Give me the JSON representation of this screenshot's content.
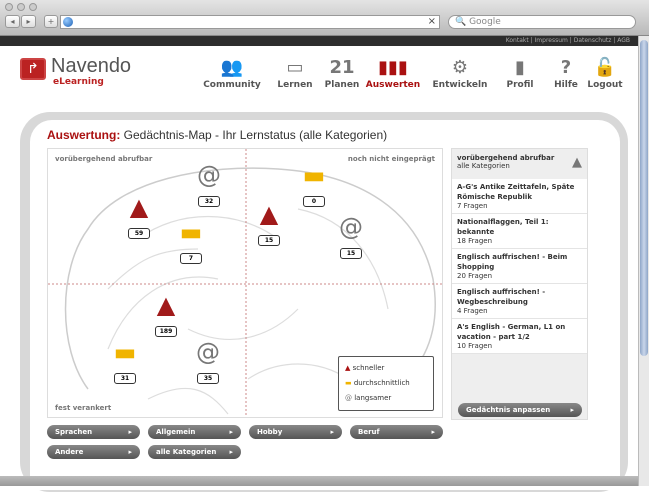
{
  "browser": {
    "search_placeholder": "Google",
    "clear": "×"
  },
  "toplinks": "Kontakt | Impressum | Datenschutz | AGB",
  "logo": {
    "name": "Navendo",
    "sub": "eLearning"
  },
  "nav": [
    {
      "label": "Community",
      "icon": "community-icon",
      "glyph": "👥"
    },
    {
      "label": "Lernen",
      "icon": "learn-icon",
      "glyph": "▭"
    },
    {
      "label": "Planen",
      "icon": "calendar-icon",
      "glyph": "21"
    },
    {
      "label": "Auswerten",
      "icon": "chart-icon",
      "glyph": "▮▮▮",
      "active": true
    },
    {
      "label": "Entwickeln",
      "icon": "gears-icon",
      "glyph": "⚙"
    },
    {
      "label": "Profil",
      "icon": "person-icon",
      "glyph": "▮"
    },
    {
      "label": "Hilfe",
      "icon": "help-icon",
      "glyph": "?"
    },
    {
      "label": "Logout",
      "icon": "lock-icon",
      "glyph": "🔓"
    }
  ],
  "page": {
    "title_bold": "Auswertung:",
    "title_rest": " Gedächtnis-Map - Ihr Lernstatus (alle Kategorien)"
  },
  "map": {
    "corners": {
      "tl": "vorübergehend abrufbar",
      "tr": "noch nicht eingeprägt",
      "bl": "fest verankert"
    },
    "markers": [
      {
        "type": "rocket",
        "count": "59"
      },
      {
        "type": "rocket",
        "count": "15"
      },
      {
        "type": "rocket",
        "count": "189"
      },
      {
        "type": "car",
        "count": "7"
      },
      {
        "type": "car",
        "count": "0"
      },
      {
        "type": "car",
        "count": "31"
      },
      {
        "type": "snail",
        "count": "32"
      },
      {
        "type": "snail",
        "count": "15"
      },
      {
        "type": "snail",
        "count": "35"
      }
    ],
    "legend": [
      "schneller",
      "durchschnittlich",
      "langsamer"
    ],
    "colors": {
      "rocket": "#a11a1a",
      "car": "#f0b400",
      "snail": "#777777"
    }
  },
  "sidebar": {
    "head": "vorübergehend abrufbar",
    "sub": "alle Kategorien",
    "items": [
      {
        "title": "A-G's Antike Zeittafeln, Späte Römische Republik",
        "count": "7 Fragen"
      },
      {
        "title": "Nationalflaggen, Teil 1: bekannte",
        "count": "18 Fragen"
      },
      {
        "title": "Englisch auffrischen! - Beim Shopping",
        "count": "20 Fragen"
      },
      {
        "title": "Englisch auffrischen! - Wegbeschreibung",
        "count": "4 Fragen"
      },
      {
        "title": "A's English - German, L1 on vacation - part 1/2",
        "count": "10 Fragen"
      }
    ],
    "button": "Gedächtnis anpassen"
  },
  "categories": [
    "Sprachen",
    "Allgemein",
    "Hobby",
    "Beruf",
    "Andere",
    "alle Kategorien"
  ]
}
